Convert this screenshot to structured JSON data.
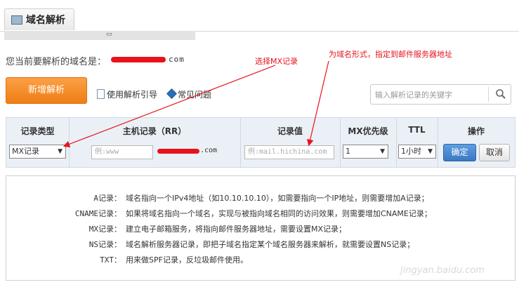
{
  "tab": {
    "label": "域名解析"
  },
  "domain": {
    "label": "您当前要解析的域名是：",
    "suffix": "com"
  },
  "toolbar": {
    "add_label": "新增解析",
    "guide_label": "使用解析引导",
    "faq_label": "常见问题",
    "search_placeholder": "输入解析记录的关键字"
  },
  "table": {
    "headers": [
      "记录类型",
      "主机记录（RR）",
      "记录值",
      "MX优先级",
      "TTL",
      "操作"
    ],
    "record_type_value": "MX记录",
    "host_placeholder": "例:www",
    "host_suffix": ".com",
    "value_placeholder": "例:mail.hichina.com",
    "mx_priority_value": "1",
    "ttl_value": "1小时",
    "confirm_label": "确定",
    "cancel_label": "取消"
  },
  "info": {
    "rows": [
      {
        "key": "A记录：",
        "value": "域名指向一个IPv4地址（如10.10.10.10），如需要指向一个IP地址，则需要增加A记录；"
      },
      {
        "key": "CNAME记录：",
        "value": "如果将域名指向一个域名，实现与被指向域名相同的访问效果，则需要增加CNAME记录；"
      },
      {
        "key": "MX记录：",
        "value": "建立电子邮箱服务，将指向邮件服务器地址，需要设置MX记录；"
      },
      {
        "key": "NS记录：",
        "value": "域名解析服务器记录，即把子域名指定某个域名服务器来解析，就需要设置NS记录；"
      },
      {
        "key": "TXT：",
        "value": "用来做SPF记录，反垃圾邮件使用。"
      }
    ]
  },
  "annotations": {
    "select_mx": "选择MX记录",
    "domain_form": "为域名形式，指定到邮件服务器地址",
    "color": "#e8121b"
  },
  "watermark": "jingyan.baidu.com"
}
